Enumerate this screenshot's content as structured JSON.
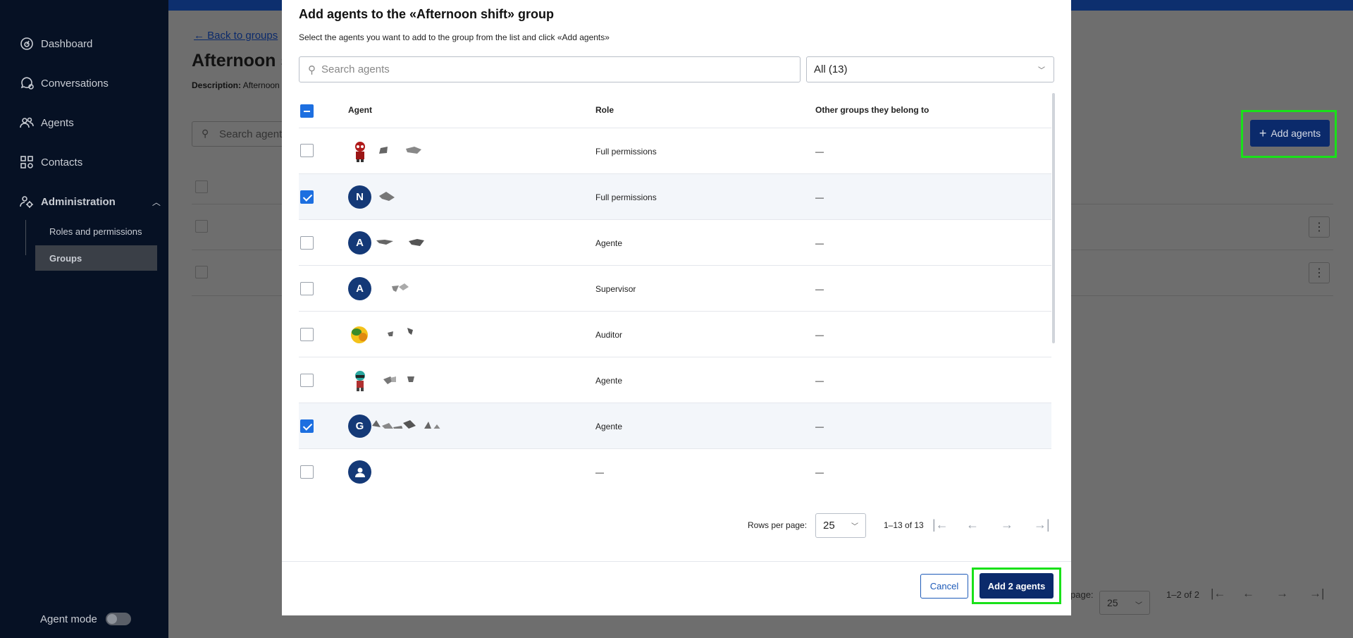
{
  "sidebar": {
    "items": [
      {
        "label": "Dashboard",
        "icon": "dashboard-icon"
      },
      {
        "label": "Conversations",
        "icon": "conversations-icon"
      },
      {
        "label": "Agents",
        "icon": "agents-icon"
      },
      {
        "label": "Contacts",
        "icon": "contacts-icon"
      },
      {
        "label": "Administration",
        "icon": "administration-icon"
      }
    ],
    "sub_items": [
      "Roles and permissions",
      "Groups"
    ],
    "agent_mode_label": "Agent mode"
  },
  "page": {
    "back_link": "← Back to groups",
    "title": "Afternoon s",
    "description_label": "Description:",
    "description_value": "Afternoon",
    "search_placeholder": "Search agents",
    "add_agents_button": "Add agents",
    "pager_rpp_label": "page:",
    "pager_rpp_value": "25",
    "pager_range": "1–2 of 2"
  },
  "modal": {
    "title": "Add agents to the «Afternoon shift» group",
    "subtitle": "Select the agents you want to add to the group from the list and click «Add agents»",
    "search_placeholder": "Search agents",
    "filter_value": "All (13)",
    "columns": [
      "Agent",
      "Role",
      "Other groups they belong to"
    ],
    "rows": [
      {
        "avatar": "",
        "role": "Full permissions",
        "groups": "—",
        "selected": false
      },
      {
        "avatar": "N",
        "role": "Full permissions",
        "groups": "—",
        "selected": true
      },
      {
        "avatar": "A",
        "role": "Agente",
        "groups": "—",
        "selected": false
      },
      {
        "avatar": "A",
        "role": "Supervisor",
        "groups": "—",
        "selected": false
      },
      {
        "avatar": "",
        "role": "Auditor",
        "groups": "—",
        "selected": false
      },
      {
        "avatar": "",
        "role": "Agente",
        "groups": "—",
        "selected": false
      },
      {
        "avatar": "G",
        "role": "Agente",
        "groups": "—",
        "selected": true
      },
      {
        "avatar": "",
        "role": "—",
        "groups": "—",
        "selected": false
      }
    ],
    "rows_per_page_label": "Rows per page:",
    "rows_per_page_value": "25",
    "range": "1–13 of 13",
    "cancel_button": "Cancel",
    "confirm_button": "Add 2 agents"
  },
  "colors": {
    "sidebar_bg": "#061124",
    "primary": "#0b2a6b",
    "checkbox_blue": "#1d6fe0",
    "highlight": "#19e119"
  }
}
